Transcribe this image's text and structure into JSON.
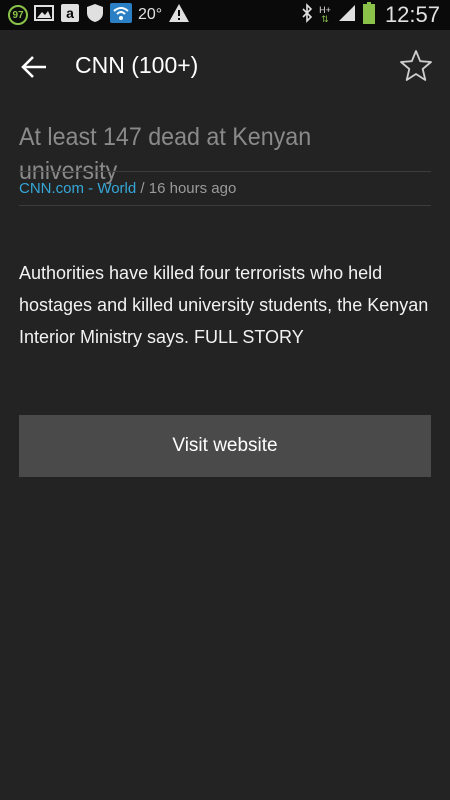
{
  "status_bar": {
    "badge_number": "97",
    "temperature": "20°",
    "network_type": "H+",
    "time": "12:57",
    "icons": [
      "image-icon",
      "amazon-icon",
      "shield-icon",
      "wifi-icon",
      "warning-icon",
      "bluetooth-icon",
      "signal-icon",
      "battery-icon"
    ]
  },
  "header": {
    "title": "CNN (100+)"
  },
  "article": {
    "headline": "At least 147 dead at Kenyan university",
    "source": "CNN.com - World",
    "separator": " / ",
    "time_ago": "16 hours ago",
    "body": "Authorities have killed four terrorists who held hostages and killed university students, the Kenyan Interior Ministry says. FULL STORY"
  },
  "actions": {
    "visit_label": "Visit website"
  },
  "colors": {
    "background": "#232323",
    "source_link": "#35a7d8",
    "button_bg": "#4a4a4a"
  }
}
